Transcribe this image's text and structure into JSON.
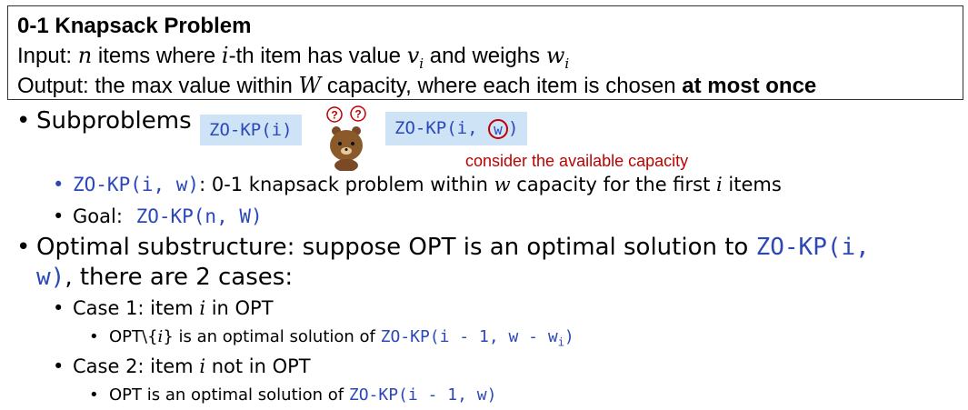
{
  "box": {
    "title": "0-1 Knapsack Problem",
    "input_1": "Input: ",
    "input_n": "n",
    "input_2": " items where ",
    "input_i": "i",
    "input_3": "-th item has value ",
    "input_v": "v",
    "input_vsub": "i",
    "input_4": " and weighs ",
    "input_w": "w",
    "input_wsub": "i",
    "output_1": "Output: the max value within ",
    "output_W": "W",
    "output_2": " capacity, where each item is chosen ",
    "output_bold": "at most once"
  },
  "sub": {
    "label": "Subproblems",
    "chip1": "ZO-KP(i)",
    "chip2_pre": "ZO-KP(i, ",
    "chip2_w": "w",
    "chip2_post": ")",
    "bubble1": "?",
    "bubble2": "?",
    "note": "consider the available capacity",
    "def_code": "ZO-KP(i, w)",
    "def_1": ": 0-1 knapsack problem within ",
    "def_w": "w",
    "def_2": " capacity for the first ",
    "def_i": "i",
    "def_3": " items",
    "goal_label": "Goal: ",
    "goal_code": "ZO-KP(n, W)"
  },
  "opt": {
    "line1_text": "Optimal substructure: suppose OPT is an optimal solution to ",
    "line1_code": "ZO-KP(i,",
    "line2_code": "w)",
    "line2_text": ", there are 2 cases:",
    "case1_a": "Case 1: item ",
    "case1_i": "i",
    "case1_b": " in OPT",
    "case1_sub_a": "OPT\\{",
    "case1_sub_i": "i",
    "case1_sub_b": "} is an optimal solution of ",
    "case1_code": "ZO-KP(i - 1, w - w",
    "case1_code_sub": "i",
    "case1_code_end": ")",
    "case2_a": "Case 2: item ",
    "case2_i": "i",
    "case2_b": " not in OPT",
    "case2_sub": "OPT is an optimal solution of ",
    "case2_code": "ZO-KP(i - 1, w)"
  }
}
